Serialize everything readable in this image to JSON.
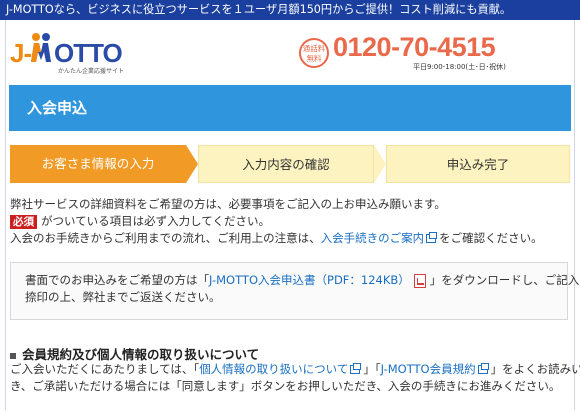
{
  "topbar": {
    "text": "J-MOTTOなら、ビジネスに役立つサービスを１ユーザ月額150円からご提供！コスト削減にも貢献。"
  },
  "header": {
    "logo": {
      "j": "J-",
      "otto": "OTTO",
      "sub": "かんたん企業応援サイト"
    },
    "tel": {
      "badge_line1": "通話料",
      "badge_line2": "無料",
      "number": "0120-70-4515",
      "hours": "平日9:00-18:00(土･日･祝休)"
    }
  },
  "page": {
    "title": "入会申込"
  },
  "steps": [
    {
      "label": "お客さま情報の入力",
      "active": true
    },
    {
      "label": "入力内容の確認",
      "active": false
    },
    {
      "label": "申込み完了",
      "active": false
    }
  ],
  "intro": {
    "line1": "弊社サービスの詳細資料をご希望の方は、必要事項をご記入の上お申込み願います。",
    "required_badge": "必須",
    "line2": "がついている項目は必ず入力してください。",
    "line3_pre": "入会のお手続きからご利用までの流れ、ご利用上の注意は、",
    "line3_link": "入会手続きのご案内",
    "line3_post": "をご確認ください。"
  },
  "docbox": {
    "pre": "書面でのお申込みをご希望の方は「",
    "link": "J-MOTTO入会申込書（PDF：124KB）",
    "post": "」をダウンロードし、ご記入、ご",
    "line2": "捺印の上、弊社までご返送ください。"
  },
  "terms": {
    "heading": "会員規約及び個人情報の取り扱いについて",
    "pre": "ご入会いただくにあたりましては、「",
    "link1": "個人情報の取り扱いについて",
    "mid": "」「",
    "link2": "J-MOTTO会員規約",
    "post": "」をよくお読みいただ",
    "line2": "き、ご承諾いただける場合には「同意します」ボタンをお押しいただき、入会の手続きにお進みください。"
  },
  "colors": {
    "topbar": "#1a3f9e",
    "title_band": "#2f96dd",
    "step_active": "#f19b26",
    "step_inactive": "#fdf3c0",
    "tel": "#e9694a",
    "link": "#1a6fc2",
    "required": "#cc2020"
  }
}
